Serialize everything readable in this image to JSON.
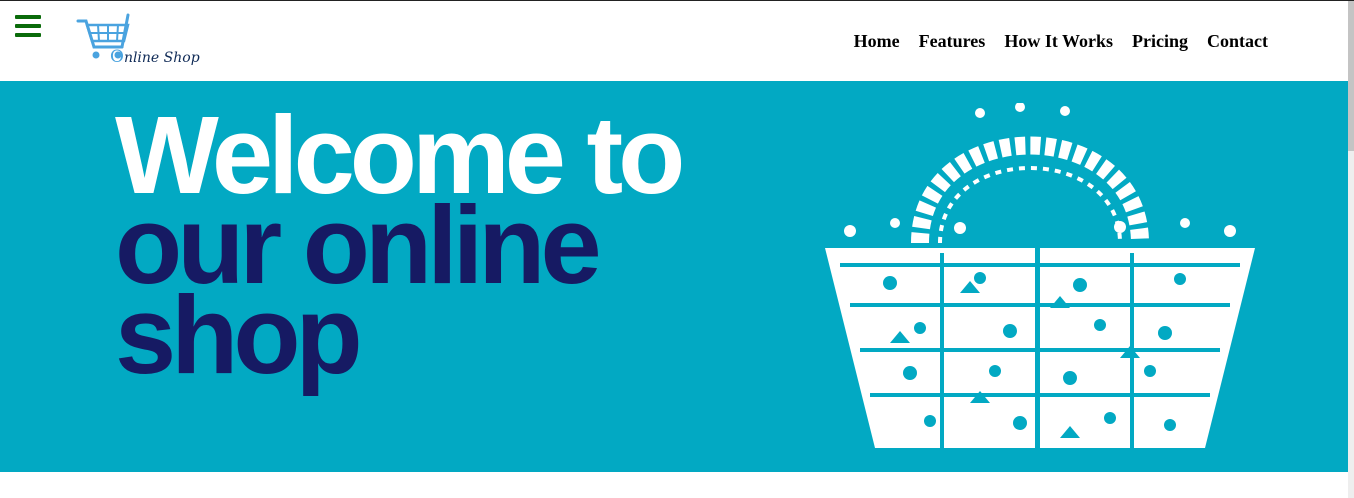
{
  "header": {
    "menu_icon": "hamburger-menu-icon",
    "logo": {
      "icon": "shopping-cart-icon",
      "text_initial": "O",
      "text_rest": "nline Shop"
    },
    "nav": [
      {
        "label": "Home"
      },
      {
        "label": "Features"
      },
      {
        "label": "How It Works"
      },
      {
        "label": "Pricing"
      },
      {
        "label": "Contact"
      }
    ]
  },
  "hero": {
    "line1": "Welcome to",
    "line2": "our online",
    "line3": "shop",
    "image_icon": "shopping-basket-icon"
  },
  "colors": {
    "hero_background": "#02a9c3",
    "hero_dark_text": "#161a63",
    "hero_light_text": "#ffffff",
    "menu_icon": "#0a6b0a",
    "logo_blue": "#4aa3df"
  }
}
